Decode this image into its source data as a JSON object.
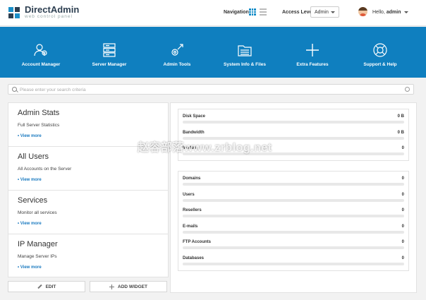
{
  "brand": {
    "title": "DirectAdmin",
    "subtitle": "web control panel"
  },
  "header": {
    "navigation_label": "Navigation",
    "access_level_label": "Access Level",
    "access_level_value": "Admin",
    "greeting": "Hello,",
    "username": "admin"
  },
  "menu": {
    "items": [
      {
        "label": "Account Manager",
        "icon": "users-icon"
      },
      {
        "label": "Server Manager",
        "icon": "server-icon"
      },
      {
        "label": "Admin Tools",
        "icon": "tools-icon"
      },
      {
        "label": "System Info & Files",
        "icon": "folder-icon"
      },
      {
        "label": "Extra Features",
        "icon": "plus-icon"
      },
      {
        "label": "Support & Help",
        "icon": "lifebuoy-icon"
      }
    ]
  },
  "search": {
    "placeholder": "Please enter your search criteria"
  },
  "widgets": [
    {
      "title": "Admin Stats",
      "description": "Full Server Statistics",
      "link": "• View more"
    },
    {
      "title": "All Users",
      "description": "All Accounts on the Server",
      "link": "• View more"
    },
    {
      "title": "Services",
      "description": "Monitor all services",
      "link": "• View more"
    },
    {
      "title": "IP Manager",
      "description": "Manage Server IPs",
      "link": "• View more"
    }
  ],
  "buttons": {
    "edit": "EDIT",
    "add_widget": "ADD WIDGET"
  },
  "usage_stats": [
    {
      "label": "Disk Space",
      "value": "0 B",
      "fill": 0
    },
    {
      "label": "Bandwidth",
      "value": "0 B",
      "fill": 0
    },
    {
      "label": "Inodes",
      "value": "0",
      "fill": 0
    }
  ],
  "count_stats": [
    {
      "label": "Domains",
      "value": "0",
      "fill": 0
    },
    {
      "label": "Users",
      "value": "0",
      "fill": 0
    },
    {
      "label": "Resellers",
      "value": "0",
      "fill": 0
    },
    {
      "label": "E-mails",
      "value": "0",
      "fill": 0
    },
    {
      "label": "FTP Accounts",
      "value": "0",
      "fill": 0
    },
    {
      "label": "Databases",
      "value": "0",
      "fill": 0
    }
  ],
  "watermark": "赵容部落www.zrblog.net",
  "colors": {
    "accent": "#0f7fbf",
    "link": "#1a7ac0"
  }
}
